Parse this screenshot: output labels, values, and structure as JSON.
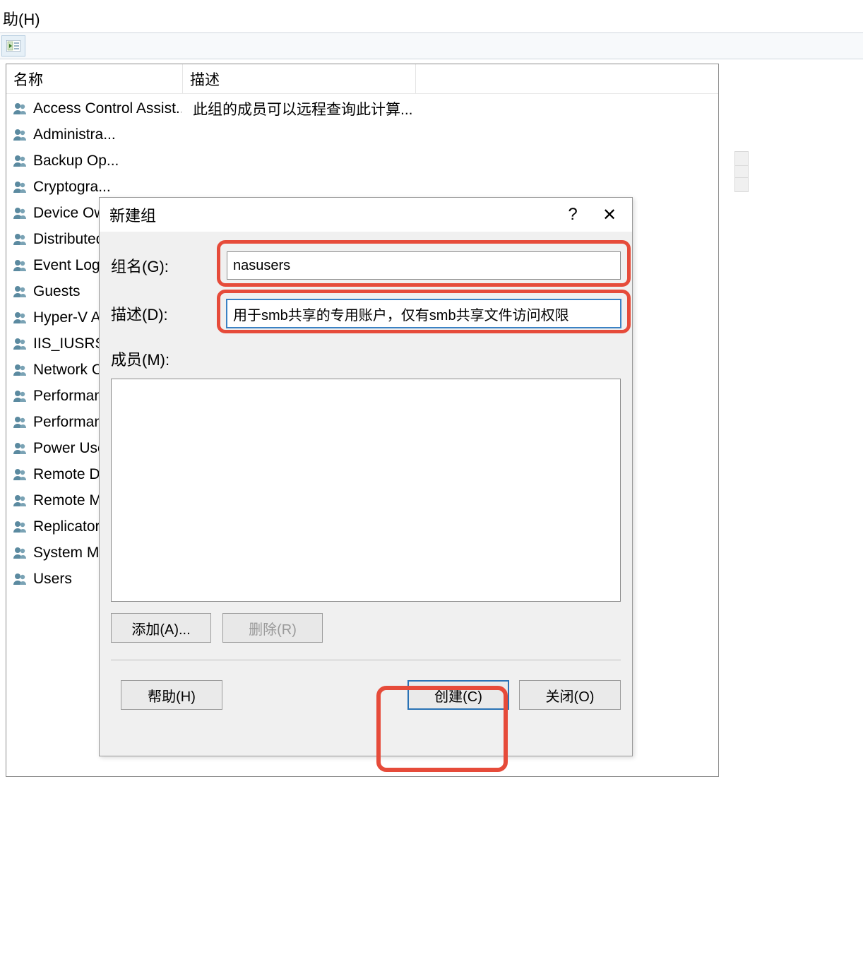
{
  "menu": {
    "help": "助(H)"
  },
  "columns": {
    "name": "名称",
    "desc": "描述"
  },
  "groups": [
    {
      "name": "Access Control Assist...",
      "desc": "此组的成员可以远程查询此计算..."
    },
    {
      "name": "Administra...",
      "desc": ""
    },
    {
      "name": "Backup Op...",
      "desc": ""
    },
    {
      "name": "Cryptogra...",
      "desc": ""
    },
    {
      "name": "Device Ow...",
      "desc": ""
    },
    {
      "name": "Distributed...",
      "desc": ""
    },
    {
      "name": "Event Log...",
      "desc": ""
    },
    {
      "name": "Guests",
      "desc": ""
    },
    {
      "name": "Hyper-V A...",
      "desc": ""
    },
    {
      "name": "IIS_IUSRS",
      "desc": ""
    },
    {
      "name": "Network C...",
      "desc": ""
    },
    {
      "name": "Performan...",
      "desc": ""
    },
    {
      "name": "Performan...",
      "desc": ""
    },
    {
      "name": "Power Use...",
      "desc": ""
    },
    {
      "name": "Remote D...",
      "desc": ""
    },
    {
      "name": "Remote M...",
      "desc": ""
    },
    {
      "name": "Replicator",
      "desc": ""
    },
    {
      "name": "System M...",
      "desc": ""
    },
    {
      "name": "Users",
      "desc": ""
    }
  ],
  "dialog": {
    "title": "新建组",
    "help_glyph": "?",
    "close_glyph": "✕",
    "groupname_label": "组名(G):",
    "groupname_value": "nasusers",
    "desc_label": "描述(D):",
    "desc_value": "用于smb共享的专用账户，仅有smb共享文件访问权限",
    "members_label": "成员(M):",
    "add_btn": "添加(A)...",
    "remove_btn": "删除(R)",
    "help_btn": "帮助(H)",
    "create_btn": "创建(C)",
    "close_btn": "关闭(O)"
  }
}
